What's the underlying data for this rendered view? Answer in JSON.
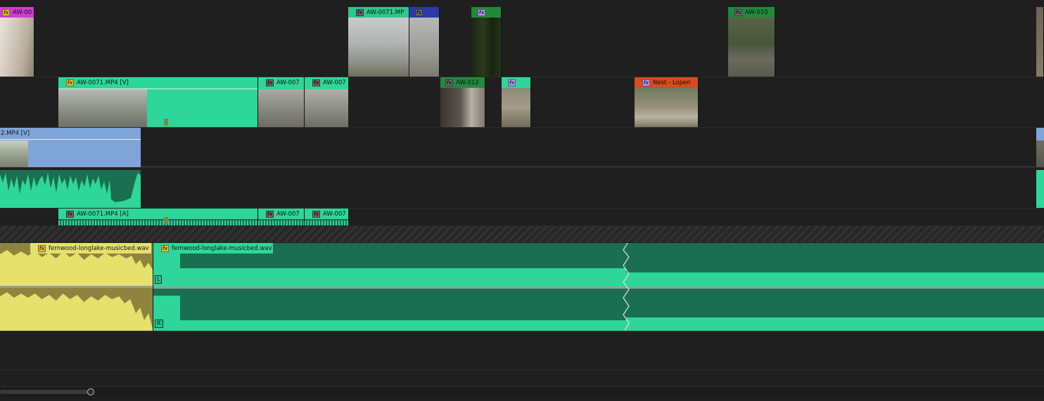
{
  "tracks": {
    "v3": [
      {
        "label": "AW-00",
        "fx": "fx",
        "badge": "yellow",
        "header_color": "#d33ad6"
      },
      {
        "label": "AW-0071.MP",
        "fx": "fx",
        "badge": "gray",
        "header_color": "#2cc98a"
      },
      {
        "label": "",
        "fx": "fx",
        "badge": "gray",
        "header_color": "#2a3aa8"
      },
      {
        "label": "",
        "fx": "fx",
        "badge": "purple",
        "header_color": "#1f8a3c"
      },
      {
        "label": "AW-010",
        "fx": "fx",
        "badge": "gray",
        "header_color": "#1f8a3c"
      }
    ],
    "v2": [
      {
        "label": "AW-0071.MP4 [V]",
        "fx": "fx",
        "badge": "yellow",
        "header_color": "#2ed69b"
      },
      {
        "label": "AW-007",
        "fx": "fx",
        "badge": "gray",
        "header_color": "#2ed69b"
      },
      {
        "label": "AW-007",
        "fx": "fx",
        "badge": "gray",
        "header_color": "#2ed69b"
      },
      {
        "label": "AW-012",
        "fx": "fx",
        "badge": "gray",
        "header_color": "#1f8a3c"
      },
      {
        "label": "",
        "fx": "fx",
        "badge": "purple",
        "header_color": "#2ed69b"
      },
      {
        "label": "Nest - Lopen",
        "fx": "fx",
        "badge": "purple",
        "header_color": "#d94a1c"
      }
    ],
    "v1": [
      {
        "label": "2.MP4 [V]",
        "header_color": "#7fa5d6"
      },
      {
        "label": "",
        "header_color": "#7fa5d6"
      }
    ],
    "a2": [
      {
        "label": "AW-0071.MP4 [A]",
        "fx": "fx",
        "badge": "gray"
      },
      {
        "label": "AW-007",
        "fx": "fx",
        "badge": "gray"
      },
      {
        "label": "AW-007",
        "fx": "fx",
        "badge": "gray"
      }
    ],
    "music": [
      {
        "label": "fernwood-longlake-musicbed.wav",
        "fx": "fx",
        "badge": "yellow"
      },
      {
        "label": "fernwood-longlake-musicbed.wav",
        "fx": "fx",
        "badge": "yellow"
      }
    ],
    "channels": {
      "left": "L",
      "right": "R"
    }
  },
  "colors": {
    "background": "#1f1f1f",
    "video_teal": "#2ed69b",
    "audio_teal": "#2ed69b",
    "audio_dark": "#1a6e51",
    "music_yellow": "#e6e06c",
    "v1_blue": "#7fa5d6",
    "magenta": "#d33ad6",
    "orange": "#d94a1c",
    "green": "#1f8a3c",
    "blue": "#2a3aa8"
  }
}
